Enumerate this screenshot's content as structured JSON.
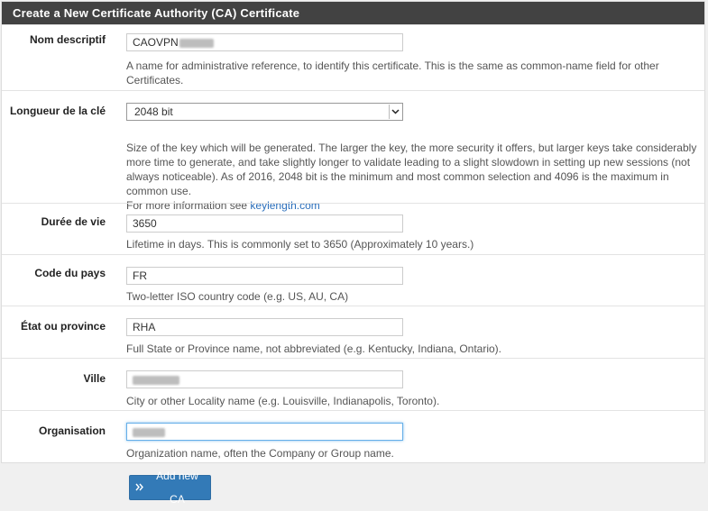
{
  "header": {
    "title": "Create a New Certificate Authority (CA) Certificate"
  },
  "fields": {
    "descr": {
      "label": "Nom descriptif",
      "value": "CAOVPN",
      "help": "A name for administrative reference, to identify this certificate. This is the same as common-name field for other Certificates."
    },
    "keylen": {
      "label": "Longueur de la clé",
      "value": "2048 bit",
      "help": "Size of the key which will be generated. The larger the key, the more security it offers, but larger keys take considerably more time to generate, and take slightly longer to validate leading to a slight slowdown in setting up new sessions (not always noticeable). As of 2016, 2048 bit is the minimum and most common selection and 4096 is the maximum in common use.",
      "help_more": "For more information see ",
      "help_link": "keylength.com"
    },
    "lifetime": {
      "label": "Durée de vie",
      "value": "3650",
      "help": "Lifetime in days. This is commonly set to 3650 (Approximately 10 years.)"
    },
    "country": {
      "label": "Code du pays",
      "value": "FR",
      "help": "Two-letter ISO country code (e.g. US, AU, CA)"
    },
    "state": {
      "label": "État ou province",
      "value": "RHA",
      "help": "Full State or Province name, not abbreviated (e.g. Kentucky, Indiana, Ontario)."
    },
    "city": {
      "label": "Ville",
      "value": "",
      "help": "City or other Locality name (e.g. Louisville, Indianapolis, Toronto)."
    },
    "org": {
      "label": "Organisation",
      "value": "",
      "help": "Organization name, often the Company or Group name."
    }
  },
  "actions": {
    "submit_label": "Add new CA"
  },
  "colors": {
    "header_bg": "#424242",
    "button_bg": "#337ab7",
    "link": "#2a6ebb"
  },
  "icons": {
    "submit": "double-chevron-right-icon",
    "select": "chevron-down-icon"
  }
}
